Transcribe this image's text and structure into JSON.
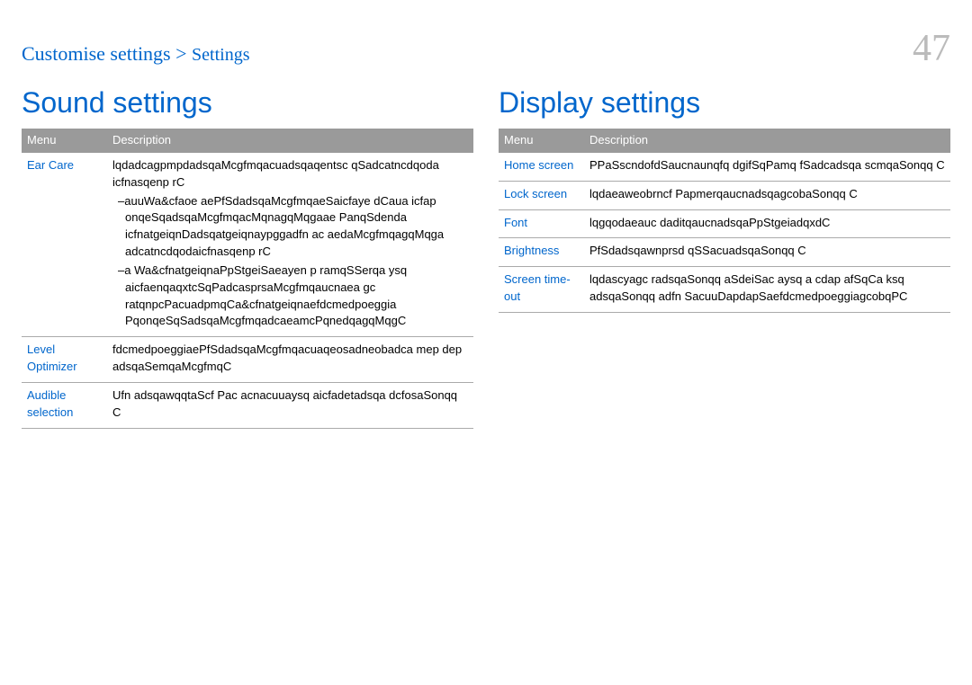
{
  "header": {
    "breadcrumb_main": "Customise settings >",
    "breadcrumb_sub": "Settings",
    "page_number": "47"
  },
  "left": {
    "title": "Sound settings",
    "columns": {
      "menu": "Menu",
      "description": "Description"
    },
    "rows": [
      {
        "menu": "Ear Care",
        "desc_lines": [
          "lqdadcagpmpdadsqaMcgfmqacuadsqaqentsc qSadcatncdqoda icfnasqenp rC",
          "–auuWa&cfaoe aePfSdadsqaMcgfmqaeSaicfaye dCaua icfap onqeSqadsqaMcgfmqacMqnagqMqgaae PanqSdenda icfnatgeiqnDadsqatgeiqnaypggadfn ac aedaMcgfmqagqMqga adcatncdqodaicfnasqenp rC",
          "–a Wa&cfnatgeiqnaPpStgeiSaeayen p ramqSSerqa ysq aicfaenqaqxtcSqPadcasprsaMcgfmqaucnaea gc ratqnpcPacuadpmqCa&cfnatgeiqnaefdcmedpoeggia PqonqeSqSadsqaMcgfmqadcaeamcPqnedqagqMqgC"
        ]
      },
      {
        "menu": "Level Optimizer",
        "desc_lines": [
          "fdcmedpoeggiaePfSdadsqaMcgfmqacuaqeosadneobadca mep dep adsqaSemqaMcgfmqC"
        ]
      },
      {
        "menu": "Audible selection",
        "desc_lines": [
          "Ufn adsqawqqtaScf Pac acnacuuaysq aicfadetadsqa dcfosaSonqq C"
        ]
      }
    ]
  },
  "right": {
    "title": "Display settings",
    "columns": {
      "menu": "Menu",
      "description": "Description"
    },
    "rows": [
      {
        "menu": "Home screen",
        "desc_lines": [
          "PPaSscndofdSaucnaunqfq dgifSqPamq fSadcadsqa scmqaSonqq C"
        ]
      },
      {
        "menu": "Lock screen",
        "desc_lines": [
          "lqdaeaweobrncf PapmerqaucnadsqagcobaSonqq C"
        ]
      },
      {
        "menu": "Font",
        "desc_lines": [
          "lqgqodaeauc daditqaucnadsqaPpStgeiadqxdC"
        ]
      },
      {
        "menu": "Brightness",
        "desc_lines": [
          "PfSdadsqawnprsd qSSacuadsqaSonqq C"
        ]
      },
      {
        "menu": "Screen time-out",
        "desc_lines": [
          "lqdascyagc radsqaSonqq aSdeiSac aysq a cdap afSqCa ksq adsqaSonqq adfn SacuuDapdapSaefdcmedpoeggiagcobqPC"
        ]
      }
    ]
  }
}
